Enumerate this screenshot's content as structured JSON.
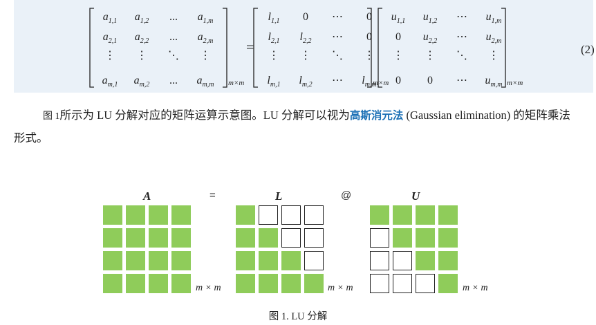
{
  "equation": {
    "number": "(2)",
    "equals": "=",
    "matrix_A": {
      "rows": [
        [
          {
            "b": "a",
            "s": "1,1"
          },
          {
            "b": "a",
            "s": "1,2"
          },
          {
            "t": "..."
          },
          {
            "b": "a",
            "s": "1,m"
          }
        ],
        [
          {
            "b": "a",
            "s": "2,1"
          },
          {
            "b": "a",
            "s": "2,2"
          },
          {
            "t": "..."
          },
          {
            "b": "a",
            "s": "2,m"
          }
        ],
        [
          {
            "t": "⋮"
          },
          {
            "t": "⋮"
          },
          {
            "t": "⋱"
          },
          {
            "t": "⋮"
          }
        ],
        [
          {
            "b": "a",
            "s": "m,1"
          },
          {
            "b": "a",
            "s": "m,2"
          },
          {
            "t": "..."
          },
          {
            "b": "a",
            "s": "m,m"
          }
        ]
      ],
      "size": "m×m"
    },
    "matrix_L": {
      "rows": [
        [
          {
            "b": "l",
            "s": "1,1"
          },
          {
            "t": "0"
          },
          {
            "t": "⋯"
          },
          {
            "t": "0"
          }
        ],
        [
          {
            "b": "l",
            "s": "2,1"
          },
          {
            "b": "l",
            "s": "2,2"
          },
          {
            "t": "⋯"
          },
          {
            "t": "0"
          }
        ],
        [
          {
            "t": "⋮"
          },
          {
            "t": "⋮"
          },
          {
            "t": "⋱"
          },
          {
            "t": "⋮"
          }
        ],
        [
          {
            "b": "l",
            "s": "m,1"
          },
          {
            "b": "l",
            "s": "m,2"
          },
          {
            "t": "⋯"
          },
          {
            "b": "l",
            "s": "m,m"
          }
        ]
      ],
      "size": "m×m"
    },
    "matrix_U": {
      "rows": [
        [
          {
            "b": "u",
            "s": "1,1"
          },
          {
            "b": "u",
            "s": "1,2"
          },
          {
            "t": "⋯"
          },
          {
            "b": "u",
            "s": "1,m"
          }
        ],
        [
          {
            "t": "0"
          },
          {
            "b": "u",
            "s": "2,2"
          },
          {
            "t": "⋯"
          },
          {
            "b": "u",
            "s": "2,m"
          }
        ],
        [
          {
            "t": "⋮"
          },
          {
            "t": "⋮"
          },
          {
            "t": "⋱"
          },
          {
            "t": "⋮"
          }
        ],
        [
          {
            "t": "0"
          },
          {
            "t": "0"
          },
          {
            "t": "⋯"
          },
          {
            "b": "u",
            "s": "m,m"
          }
        ]
      ],
      "size": "m×m"
    }
  },
  "paragraph": {
    "fig_ref": "图 1",
    "text_1": "所示为 LU 分解对应的矩阵运算示意图。LU 分解可以视为",
    "highlight": "高斯消元法",
    "text_2": " (Gaussian elimination) 的矩阵乘法形式。"
  },
  "figure": {
    "label_A": "A",
    "op_equals": "=",
    "label_L": "L",
    "op_matmul": "@",
    "label_U": "U",
    "dim_label": "m × m",
    "green_color": "#8fcc5a",
    "caption": "图 1. LU 分解",
    "grid_A": [
      [
        1,
        1,
        1,
        1
      ],
      [
        1,
        1,
        1,
        1
      ],
      [
        1,
        1,
        1,
        1
      ],
      [
        1,
        1,
        1,
        1
      ]
    ],
    "grid_L": [
      [
        1,
        0,
        0,
        0
      ],
      [
        1,
        1,
        0,
        0
      ],
      [
        1,
        1,
        1,
        0
      ],
      [
        1,
        1,
        1,
        1
      ]
    ],
    "grid_U": [
      [
        1,
        1,
        1,
        1
      ],
      [
        0,
        1,
        1,
        1
      ],
      [
        0,
        0,
        1,
        1
      ],
      [
        0,
        0,
        0,
        1
      ]
    ]
  }
}
